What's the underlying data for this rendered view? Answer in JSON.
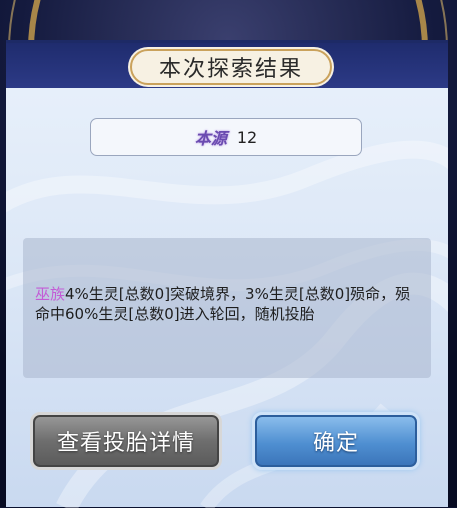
{
  "dialog": {
    "title": "本次探索结果",
    "resource": {
      "name": "本源",
      "value": "12"
    },
    "message": {
      "tribe": "巫族",
      "text": "4%生灵[总数0]突破境界，3%生灵[总数0]殒命，殒命中60%生灵[总数0]进入轮回，随机投胎"
    }
  },
  "buttons": {
    "details_label": "查看投胎详情",
    "confirm_label": "确定"
  },
  "colors": {
    "header": "#1f2c6e",
    "tribe_text": "#c35bd6",
    "confirm_button": "#4f8fd1",
    "details_button": "#6e6e6e"
  }
}
